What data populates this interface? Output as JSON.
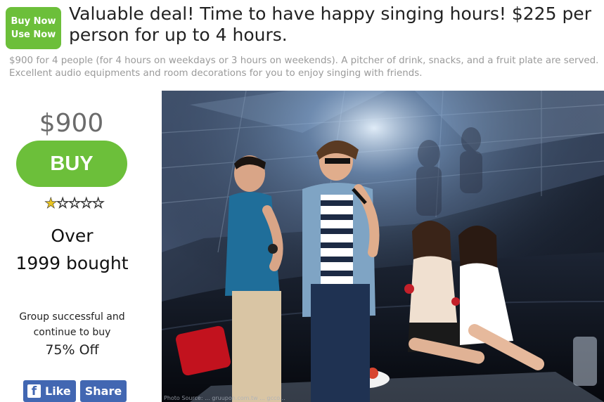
{
  "badge": {
    "line1": "Buy Now",
    "line2": "Use Now"
  },
  "deal": {
    "title": "Valuable deal!  Time to have happy singing hours!  $225 per person for up to 4 hours.",
    "description": "$900 for 4 people (for 4 hours on weekdays or 3 hours on weekends).  A pitcher of drink, snacks, and a fruit plate are served. Excellent audio equipments and room decorations  for you to enjoy singing with friends.",
    "price": "$900",
    "buy_label": "BUY",
    "rating": {
      "filled": 1,
      "total": 5,
      "filled_glyph": "★",
      "empty_glyph": "☆"
    },
    "bought_line1": "Over",
    "bought_line2": "1999 bought",
    "group_status": "Group successful and continue to buy",
    "discount": "75% Off"
  },
  "social": {
    "like_label": "Like",
    "share_label": "Share",
    "fb_glyph": "f"
  },
  "photo": {
    "description": "karaoke room photo",
    "credit": "Photo Source: ... gruupon.com.tw ... gcco..."
  },
  "colors": {
    "brand_green": "#6cbf3a",
    "facebook_blue": "#4267b2",
    "star_gold": "#e8c322",
    "muted_text": "#9a9a9a"
  }
}
